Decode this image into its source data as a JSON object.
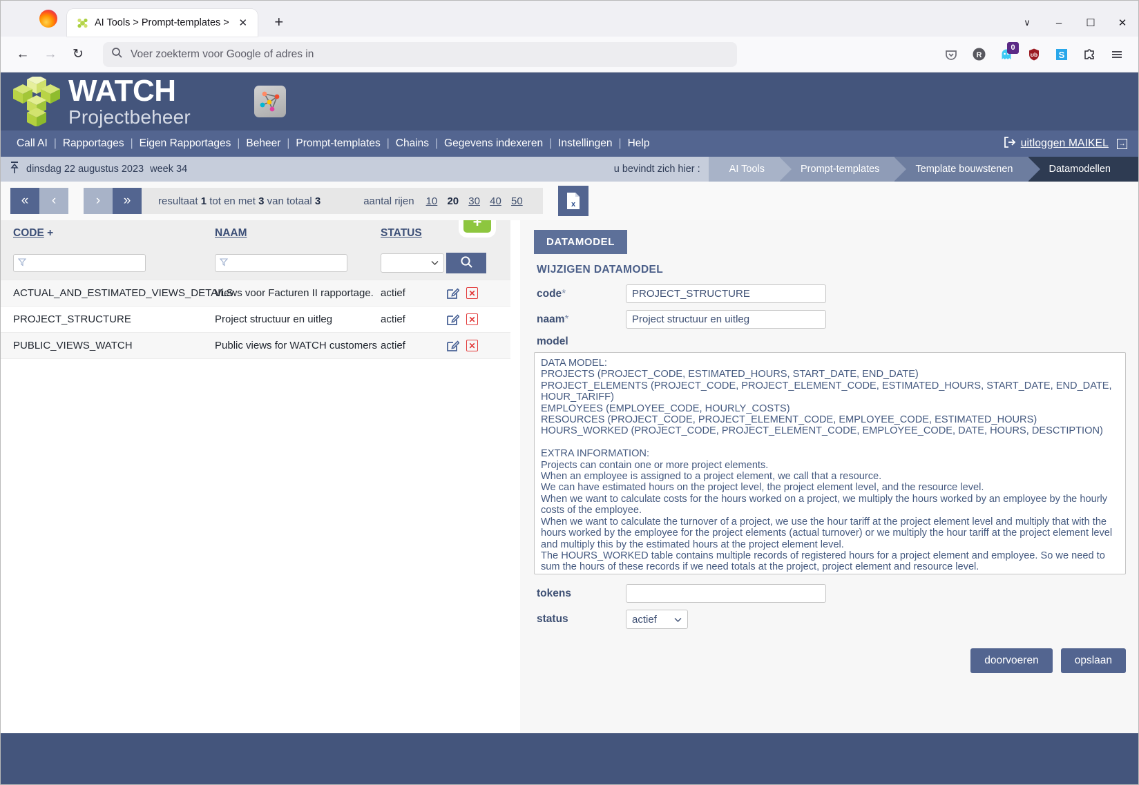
{
  "browser": {
    "tab_title": "AI Tools > Prompt-templates >",
    "tab_chevron": ">",
    "close_label": "✕",
    "newtab_label": "+",
    "back_label": "←",
    "forward_label": "→",
    "reload_label": "↻",
    "url_placeholder": "Voer zoekterm voor Google of adres in",
    "notification_badge": "0",
    "win_minimize": "–",
    "win_maximize": "☐",
    "win_close": "✕",
    "win_chevron": "∨"
  },
  "masthead": {
    "brand_line1": "WATCH",
    "brand_line2": "Projectbeheer"
  },
  "nav": {
    "items": [
      {
        "label": "Call AI"
      },
      {
        "label": "Rapportages"
      },
      {
        "label": "Eigen Rapportages"
      },
      {
        "label": "Beheer"
      },
      {
        "label": "Prompt-templates"
      },
      {
        "label": "Chains"
      },
      {
        "label": "Gegevens indexeren"
      },
      {
        "label": "Instellingen"
      },
      {
        "label": "Help"
      }
    ],
    "separator": "|",
    "logout_label": "uitloggen MAIKEL",
    "logout_badge": "→"
  },
  "crumbbar": {
    "date": "dinsdag 22 augustus 2023",
    "week": "week 34",
    "here_label": "u bevindt zich hier :",
    "crumbs": [
      "AI Tools",
      "Prompt-templates",
      "Template bouwstenen",
      "Datamodellen"
    ]
  },
  "toolbar": {
    "first_label": "«",
    "prev_label": "‹",
    "next_label": "›",
    "last_label": "»",
    "result_prefix": "resultaat",
    "result_from": "1",
    "result_mid": "tot en met",
    "result_to": "3",
    "result_of": "van totaal",
    "result_total": "3",
    "rows_label": "aantal rijen",
    "rows_options": [
      "10",
      "20",
      "30",
      "40",
      "50"
    ],
    "rows_selected": "20",
    "export_icon": "excel-export-icon"
  },
  "grid": {
    "add_label": "+",
    "columns": [
      {
        "label": "CODE",
        "sort": "+"
      },
      {
        "label": "NAAM",
        "sort": ""
      },
      {
        "label": "STATUS",
        "sort": ""
      }
    ],
    "filters": {
      "code_value": "",
      "naam_value": "",
      "status_value": "",
      "search_icon": "search-icon",
      "filter_icon": "filter-icon"
    },
    "rows": [
      {
        "code": "ACTUAL_AND_ESTIMATED_VIEWS_DETAILS",
        "naam": "Views voor Facturen II rapportage.",
        "status": "actief"
      },
      {
        "code": "PROJECT_STRUCTURE",
        "naam": "Project structuur en uitleg",
        "status": "actief"
      },
      {
        "code": "PUBLIC_VIEWS_WATCH",
        "naam": "Public views for WATCH customers",
        "status": "actief"
      }
    ],
    "edit_icon": "edit-icon",
    "delete_icon": "delete-icon"
  },
  "detail": {
    "tab_label": "DATAMODEL",
    "form_title": "WIJZIGEN DATAMODEL",
    "code_label": "code",
    "code_required": "*",
    "code_value": "PROJECT_STRUCTURE",
    "naam_label": "naam",
    "naam_required": "*",
    "naam_value": "Project structuur en uitleg",
    "model_label": "model",
    "model_value": "DATA MODEL:\nPROJECTS (PROJECT_CODE, ESTIMATED_HOURS, START_DATE, END_DATE)\nPROJECT_ELEMENTS (PROJECT_CODE, PROJECT_ELEMENT_CODE, ESTIMATED_HOURS, START_DATE, END_DATE, HOUR_TARIFF)\nEMPLOYEES (EMPLOYEE_CODE, HOURLY_COSTS)\nRESOURCES (PROJECT_CODE, PROJECT_ELEMENT_CODE, EMPLOYEE_CODE, ESTIMATED_HOURS)\nHOURS_WORKED (PROJECT_CODE, PROJECT_ELEMENT_CODE, EMPLOYEE_CODE, DATE, HOURS, DESCTIPTION)\n\nEXTRA INFORMATION:\nProjects can contain one or more project elements.\nWhen an employee is assigned to a project element, we call that a resource.\nWe can have estimated hours on the project level, the project element level, and the resource level.\nWhen we want to calculate costs for the hours worked on a project, we multiply the hours worked by an employee by the hourly costs of the employee.\nWhen we want to calculate the turnover of a project, we use the hour tariff at the project element level and multiply that with the hours worked by the employee for the project elements (actual turnover) or we multiply the hour tariff at the project element level and multiply this by the estimated hours at the project element level.\nThe HOURS_WORKED table contains multiple records of registered hours for a project element and employee. So we need to sum the hours of these records if we need totals at the project, project element and resource level.",
    "tokens_label": "tokens",
    "tokens_value": "",
    "status_label": "status",
    "status_value": "actief",
    "status_caret": "⌄",
    "commit_label": "doorvoeren",
    "save_label": "opslaan"
  },
  "colors": {
    "header_blue": "#44557c",
    "nav_blue": "#536590",
    "crumb_bar": "#c6cddb",
    "accent_green": "#8dc63f",
    "delete_red": "#e23a3a"
  }
}
